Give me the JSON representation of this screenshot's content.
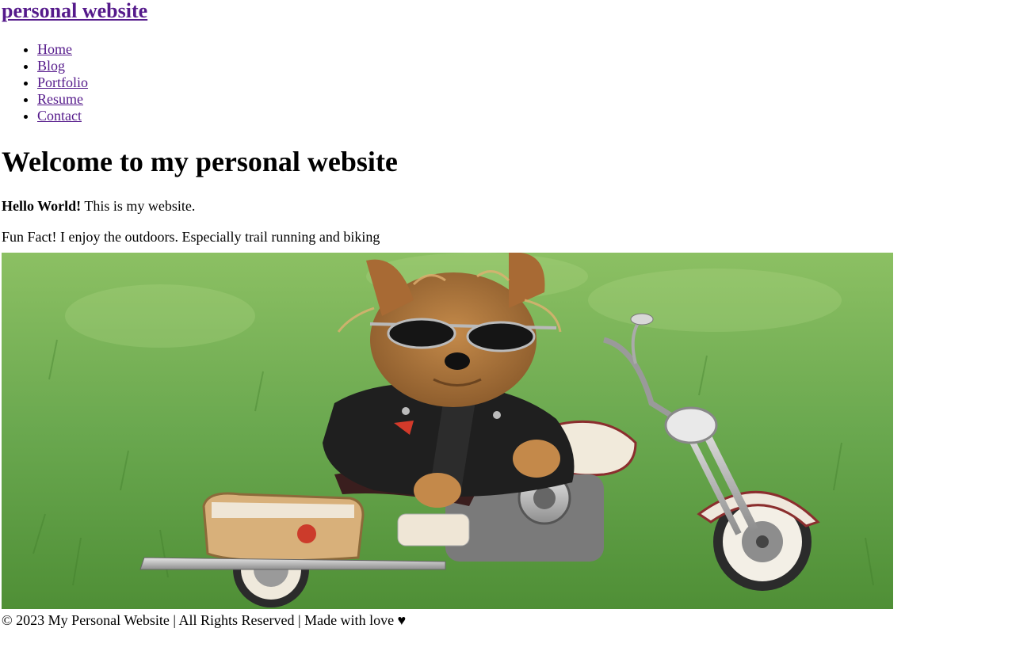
{
  "header": {
    "site_title": "personal website"
  },
  "nav": {
    "items": [
      {
        "label": "Home"
      },
      {
        "label": "Blog"
      },
      {
        "label": "Portfolio"
      },
      {
        "label": "Resume"
      },
      {
        "label": "Contact"
      }
    ]
  },
  "main": {
    "heading": "Welcome to my personal website",
    "intro_bold": "Hello World!",
    "intro_rest": " This is my website.",
    "fun_fact": "Fun Fact! I enjoy the outdoors. Especially trail running and biking"
  },
  "footer": {
    "text": "© 2023 My Personal Website | All Rights Reserved | Made with love ♥"
  },
  "colors": {
    "link_visited": "#551a8b",
    "grass": "#6aa84f"
  }
}
